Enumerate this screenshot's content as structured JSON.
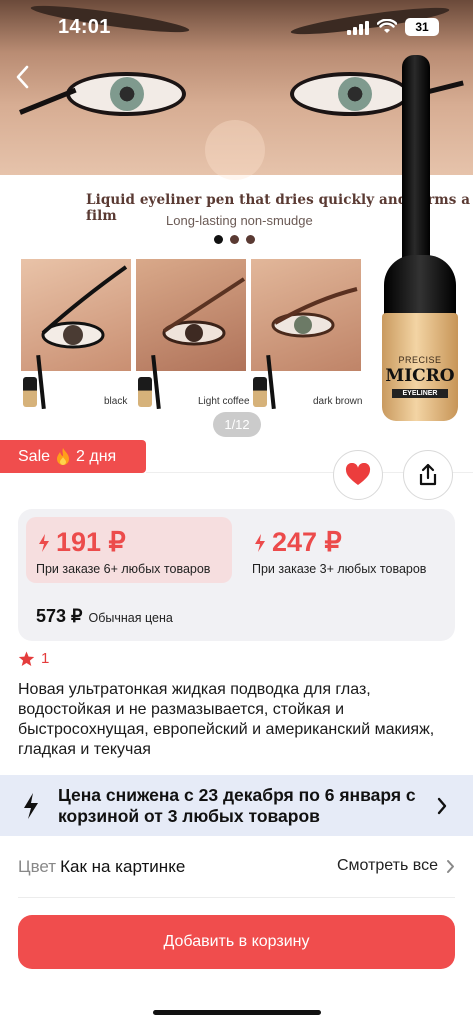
{
  "status_bar": {
    "time": "14:01",
    "battery": "31"
  },
  "gallery": {
    "promo_title": "Liquid eyeliner pen that dries quickly and forms a film",
    "promo_subtitle": "Long-lasting non-smudge",
    "shades": [
      "black",
      "Light coffee",
      "dark brown"
    ],
    "bottle_text": {
      "line1": "PRECISE",
      "line2": "MICRO",
      "line3": "EYELINER"
    },
    "counter": "1/12",
    "dot_colors": [
      "#111111",
      "#5a3a33",
      "#5a3a33"
    ]
  },
  "sale": {
    "label": "Sale",
    "duration": "2 дня",
    "icon": "fire-icon"
  },
  "actions": {
    "favorite_icon": "heart-icon",
    "share_icon": "share-icon"
  },
  "pricing": {
    "tiers": [
      {
        "price": "191 ₽",
        "note": "При заказе 6+ любых товаров"
      },
      {
        "price": "247 ₽",
        "note": "При заказе 3+ любых товаров"
      }
    ],
    "regular_price": "573 ₽",
    "regular_label": "Обычная цена"
  },
  "rating": {
    "value": "1"
  },
  "product": {
    "title": "Новая ультратонкая жидкая подводка для глаз, водостойкая и не размазывается, стойкая и быстросохнущая, европейский и американский макияж, гладкая и текучая"
  },
  "promo": {
    "text": "Цена снижена с 23 декабря по 6 января с корзиной от 3 любых товаров"
  },
  "color_option": {
    "label": "Цвет",
    "value": "Как на картинке",
    "see_all": "Смотреть все"
  },
  "cart": {
    "label": "Добавить в корзину"
  },
  "colors": {
    "accent": "#f04d4d",
    "price_red": "#ec4b4b",
    "promo_bg": "#e6ebf7",
    "card_bg": "#f1f1f4"
  }
}
